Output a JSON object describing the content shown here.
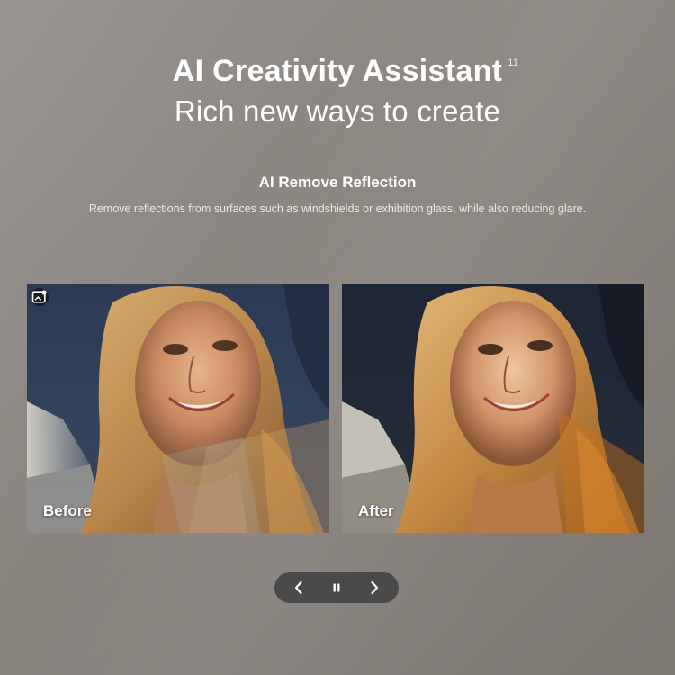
{
  "header": {
    "title": "AI Creativity Assistant",
    "title_footnote": "11",
    "subtitle": "Rich new ways to create"
  },
  "feature": {
    "title": "AI Remove Reflection",
    "description": "Remove reflections from surfaces such as windshields or exhibition glass, while also reducing glare."
  },
  "comparison": {
    "before_label": "Before",
    "after_label": "After",
    "badge_icon": "ai-image-icon"
  },
  "carousel_controls": {
    "previous_icon": "chevron-left-icon",
    "pause_icon": "pause-icon",
    "next_icon": "chevron-right-icon"
  },
  "colors": {
    "background": "#8b8580",
    "controls_bg": "#4a4a4a",
    "text": "#ffffff"
  }
}
